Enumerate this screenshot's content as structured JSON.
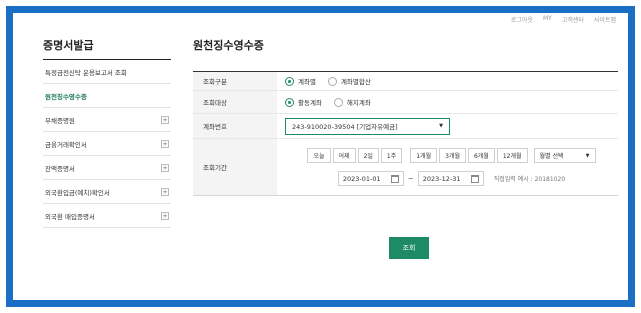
{
  "topnav": [
    "로그아웃",
    "MY",
    "고객센터",
    "사이트맵"
  ],
  "sidebar": {
    "title": "증명서발급",
    "items": [
      {
        "label": "특정금전신탁 운용보고서 조회",
        "plus": ""
      },
      {
        "label": "원천징수영수증",
        "plus": ""
      },
      {
        "label": "부채증명원",
        "plus": "+"
      },
      {
        "label": "금융거래확인서",
        "plus": "+"
      },
      {
        "label": "잔액증명서",
        "plus": "+"
      },
      {
        "label": "외국환입금(예치)확인서",
        "plus": "+"
      },
      {
        "label": "외국환 매입증명서",
        "plus": "+"
      }
    ]
  },
  "main": {
    "title": "원천징수영수증",
    "rows": {
      "type": {
        "label": "조회구분",
        "options": [
          "계좌별",
          "계좌별합산"
        ]
      },
      "target": {
        "label": "조회대상",
        "options": [
          "활동계좌",
          "해지계좌"
        ]
      },
      "account": {
        "label": "계좌번호",
        "value": "243-910020-39504 [기업자유예금]"
      },
      "period": {
        "label": "조회기간",
        "buttons": [
          "오늘",
          "어제",
          "2일",
          "1주",
          "1개월",
          "3개월",
          "6개월",
          "12개월"
        ],
        "month_select": "월별 선택",
        "start_date": "2023-01-01",
        "tilde": "~",
        "end_date": "2023-12-31",
        "hint": "직접입력 예시 : 20181020"
      }
    },
    "submit": "조회"
  },
  "colors": {
    "accent": "#1f8a66",
    "frame": "#1a6fc4"
  }
}
